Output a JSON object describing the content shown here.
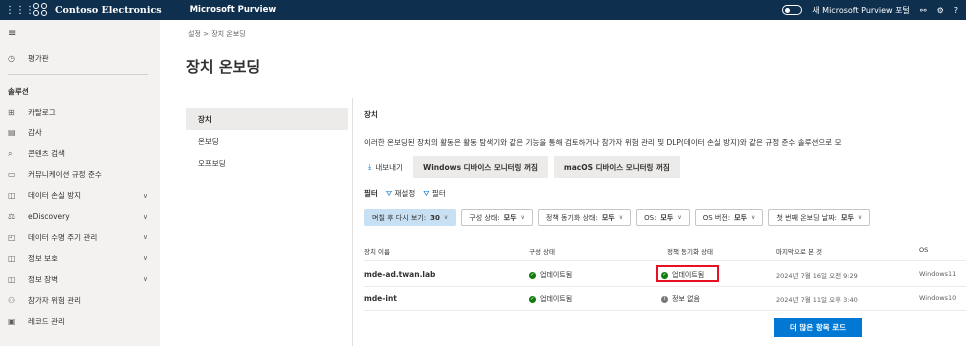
{
  "header": {
    "org_name": "Contoso Electronics",
    "app_name": "Microsoft Purview",
    "new_portal_label": "새 Microsoft Purview 포털",
    "help_label": "?"
  },
  "sidebar": {
    "dashboard": "평가판",
    "section_heading": "솔루션",
    "items": [
      {
        "label": "카탈로그",
        "icon": "catalog-icon",
        "chevron": false
      },
      {
        "label": "감사",
        "icon": "audit-icon",
        "chevron": false
      },
      {
        "label": "콘텐츠 검색",
        "icon": "search-icon",
        "chevron": false
      },
      {
        "label": "커뮤니케이션 규정 준수",
        "icon": "communication-icon",
        "chevron": false
      },
      {
        "label": "데이터 손실 방지",
        "icon": "dlp-icon",
        "chevron": true
      },
      {
        "label": "eDiscovery",
        "icon": "ediscovery-icon",
        "chevron": true
      },
      {
        "label": "데이터 수명 주기 관리",
        "icon": "lifecycle-icon",
        "chevron": true
      },
      {
        "label": "정보 보호",
        "icon": "info-protection-icon",
        "chevron": true
      },
      {
        "label": "정보 장벽",
        "icon": "info-barrier-icon",
        "chevron": true
      },
      {
        "label": "참가자 위험 관리",
        "icon": "insider-risk-icon",
        "chevron": false
      },
      {
        "label": "레코드 관리",
        "icon": "records-icon",
        "chevron": false
      }
    ]
  },
  "breadcrumb": "설정 > 장치 온보딩",
  "page_title": "장치 온보딩",
  "subnav": [
    "장치",
    "온보딩",
    "오프보딩"
  ],
  "section": {
    "title": "장치",
    "description": "이러한 온보딩된 장치의 활동은 활동 탐색기와 같은 기능을 통해 검토하거나 참가자 위험 관리 및 DLP(데이터 손실 방지)와 같은 규정 준수 솔루션으로 모"
  },
  "toolbar": {
    "export": "내보내기",
    "windows_btn": "Windows 디바이스 모니터링 꺼짐",
    "macos_btn": "macOS 디바이스 모니터링 꺼짐"
  },
  "filter": {
    "label": "필터",
    "reset": "재설정",
    "filters": "필터"
  },
  "chips": [
    {
      "label": "며칠 후 다시 보기:",
      "value": "30"
    },
    {
      "label": "구성 상태:",
      "value": "모두"
    },
    {
      "label": "정책 동기화 상태:",
      "value": "모두"
    },
    {
      "label": "OS:",
      "value": "모두"
    },
    {
      "label": "OS 버전:",
      "value": "모두"
    },
    {
      "label": "첫 번째 온보딩 날짜:",
      "value": "모두"
    }
  ],
  "table": {
    "columns": [
      "장치 이름",
      "구성 상태",
      "정책 동기화 상태",
      "마지막으로 본 것",
      "OS"
    ],
    "rows": [
      {
        "name": "mde-ad.twan.lab",
        "config": "업데이트됨",
        "policy": "업데이트됨",
        "last_seen": "2024년 7월 16일 오전 9:29",
        "os": "Windows11"
      },
      {
        "name": "mde-int",
        "config": "업데이트됨",
        "policy": "정보 없음",
        "last_seen": "2024년 7월 11일 오후 3:40",
        "os": "Windows10"
      }
    ]
  },
  "load_more": "더 많은 항목 로드"
}
